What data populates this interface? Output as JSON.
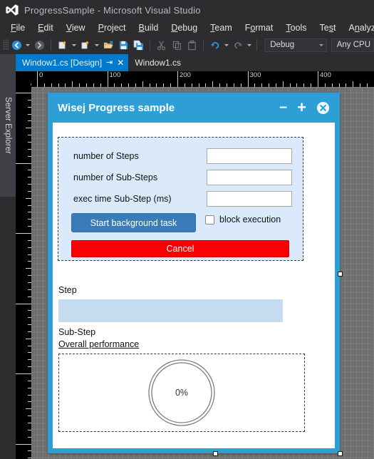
{
  "window": {
    "title": "ProgressSample - Microsoft Visual Studio",
    "logo_icon": "visual-studio-logo-icon"
  },
  "menu": {
    "items": [
      {
        "label": "File",
        "mnemonic": "F",
        "rest": "ile"
      },
      {
        "label": "Edit",
        "mnemonic": "E",
        "rest": "dit"
      },
      {
        "label": "View",
        "mnemonic": "V",
        "rest": "iew"
      },
      {
        "label": "Project",
        "mnemonic": "P",
        "rest": "roject"
      },
      {
        "label": "Build",
        "mnemonic": "B",
        "rest": "uild"
      },
      {
        "label": "Debug",
        "mnemonic": "D",
        "rest": "ebug"
      },
      {
        "label": "Team",
        "mnemonic": "T",
        "rest": "eam"
      },
      {
        "label": "Format",
        "mnemonic": "o",
        "rest": "rmat"
      },
      {
        "label": "Tools",
        "mnemonic": "T",
        "rest": "ools"
      },
      {
        "label": "Test",
        "mnemonic": "s",
        "rest": "t"
      },
      {
        "label": "Analyze",
        "mnemonic": "n",
        "rest": "alyze"
      }
    ]
  },
  "toolbar": {
    "icons": [
      "navigate-backward-icon",
      "navigate-forward-icon",
      "new-project-icon",
      "new-item-icon",
      "open-file-icon",
      "save-icon",
      "save-all-icon",
      "cut-icon",
      "copy-icon",
      "paste-icon",
      "undo-icon",
      "redo-icon"
    ],
    "configuration": "Debug",
    "platform": "Any CPU"
  },
  "leftdock": {
    "tab_label": "Server Explorer"
  },
  "tabs": [
    {
      "label": "Window1.cs [Design]",
      "active": true,
      "pin_icon": "pin-icon",
      "close_icon": "close-icon"
    },
    {
      "label": "Window1.cs",
      "active": false
    }
  ],
  "rulers": {
    "corner_label": "0",
    "horizontal_labels": [
      "0",
      "100",
      "200",
      "300",
      "400"
    ],
    "vertical_labels": [
      "0",
      "100",
      "200",
      "300",
      "400",
      "500"
    ]
  },
  "form": {
    "title": "Wisej Progress sample",
    "titlebar_color": "#2e9fd6",
    "controls": {
      "minimize": "−",
      "maximize": "+",
      "close_icon": "close-circle-icon"
    },
    "fields": [
      {
        "label": "number of Steps",
        "value": "",
        "placeholder": ""
      },
      {
        "label": "number of Sub-Steps",
        "value": "",
        "placeholder": ""
      },
      {
        "label": "exec time Sub-Step (ms)",
        "value": "",
        "placeholder": ""
      }
    ],
    "start_button": {
      "label": "Start background task",
      "color": "#3a7cb8"
    },
    "block_checkbox": {
      "label": "block execution",
      "checked": false
    },
    "cancel_button": {
      "label": "Cancel",
      "color": "#fb0000"
    },
    "step_label": "Step",
    "substep_label": "Sub-Step",
    "overall_link": "Overall performance",
    "progress_value": 0,
    "gauge": {
      "percent_text": "0%",
      "value": 0
    }
  }
}
